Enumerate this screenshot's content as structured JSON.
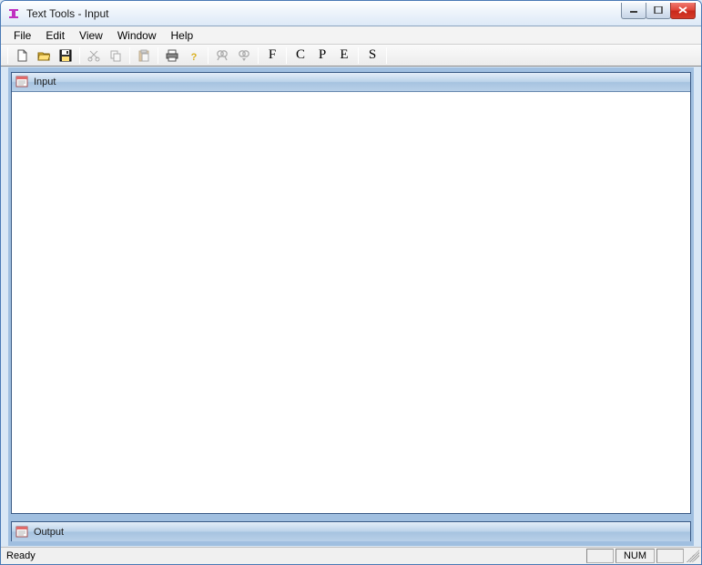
{
  "window": {
    "title": "Text Tools - Input"
  },
  "menubar": {
    "items": [
      "File",
      "Edit",
      "View",
      "Window",
      "Help"
    ]
  },
  "toolbar": {
    "letter_F": "F",
    "letter_C": "C",
    "letter_P": "P",
    "letter_E": "E",
    "letter_S": "S"
  },
  "panels": {
    "input": {
      "title": "Input"
    },
    "output": {
      "title": "Output"
    }
  },
  "statusbar": {
    "text": "Ready",
    "num": "NUM"
  }
}
